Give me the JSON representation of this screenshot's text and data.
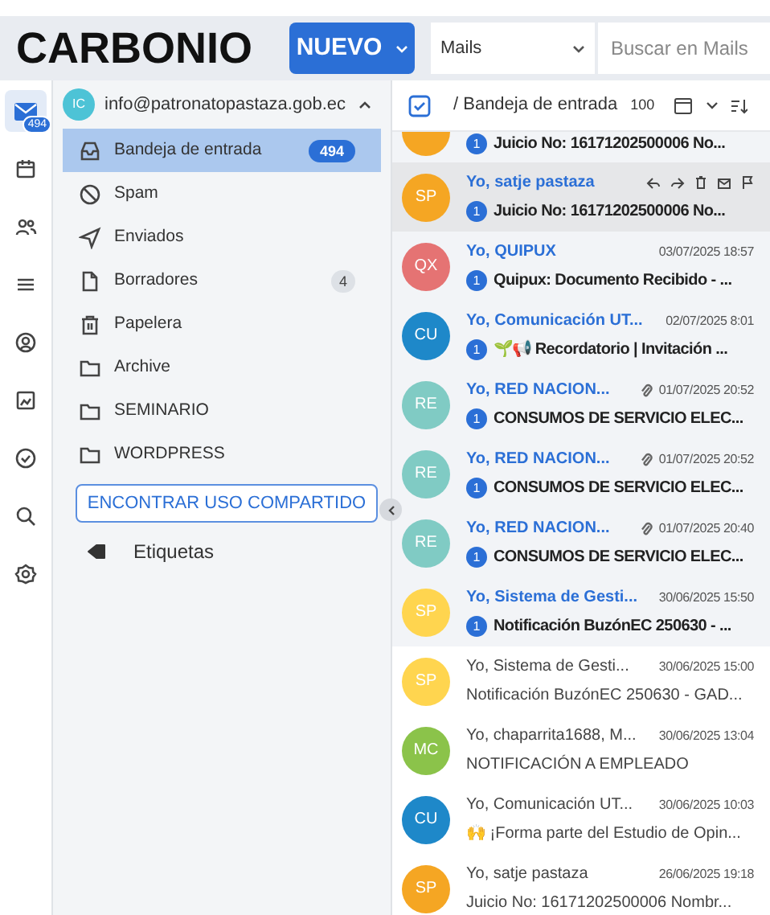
{
  "header": {
    "logo": "CARBONIO",
    "new_button": "NUEVO",
    "search_scope": "Mails",
    "search_placeholder": "Buscar en Mails"
  },
  "rail": [
    {
      "kind": "mail",
      "badge": "494",
      "selected": true
    },
    {
      "kind": "calendar",
      "selected": false
    },
    {
      "kind": "contacts",
      "selected": false
    },
    {
      "kind": "tasks",
      "selected": false
    },
    {
      "kind": "support",
      "selected": false
    },
    {
      "kind": "files",
      "selected": false
    },
    {
      "kind": "check",
      "selected": false
    },
    {
      "kind": "search",
      "selected": false
    },
    {
      "kind": "settings",
      "selected": false
    }
  ],
  "account": {
    "initials": "IC",
    "email": "info@patronatopastaza.gob.ec",
    "expanded": true
  },
  "folders": [
    {
      "kind": "inbox",
      "label": "Bandeja de entrada",
      "count": "494",
      "selected": true
    },
    {
      "kind": "spam",
      "label": "Spam",
      "selected": false
    },
    {
      "kind": "sent",
      "label": "Enviados",
      "selected": false
    },
    {
      "kind": "drafts",
      "label": "Borradores",
      "count": "4",
      "selected": false
    },
    {
      "kind": "trash",
      "label": "Papelera",
      "selected": false
    },
    {
      "kind": "folder",
      "label": "Archive",
      "selected": false
    },
    {
      "kind": "folder",
      "label": "SEMINARIO",
      "selected": false
    },
    {
      "kind": "folder",
      "label": "WORDPRESS",
      "selected": false
    }
  ],
  "shared_button": "ENCONTRAR USO COMPARTIDO",
  "tags_label": "Etiquetas",
  "list_header": {
    "path": "/ Bandeja de entrada",
    "count": "100"
  },
  "messages": [
    {
      "color": "#f5a623",
      "subject": "Juicio No: 16171202500006 No...",
      "unread": true,
      "badge": "1",
      "partial": true
    },
    {
      "initials": "SP",
      "color": "#f5a623",
      "sender": "Yo, satje pastaza",
      "subject": "Juicio No: 16171202500006 No...",
      "unread": true,
      "badge": "1",
      "hovered": true
    },
    {
      "initials": "QX",
      "color": "#e57373",
      "sender": "Yo, QUIPUX",
      "date": "03/07/2025 18:57",
      "subject": "Quipux: Documento Recibido - ...",
      "unread": true,
      "badge": "1"
    },
    {
      "initials": "CU",
      "color": "#1e88c9",
      "sender": "Yo, Comunicación UT...",
      "date": "02/07/2025 8:01",
      "subject": "🌱📢 Recordatorio | Invitación ...",
      "unread": true,
      "badge": "1"
    },
    {
      "initials": "RE",
      "color": "#80cbc4",
      "sender": "Yo, RED NACION...",
      "date": "01/07/2025 20:52",
      "subject": "CONSUMOS DE SERVICIO ELEC...",
      "unread": true,
      "badge": "1",
      "attachment": true
    },
    {
      "initials": "RE",
      "color": "#80cbc4",
      "sender": "Yo, RED NACION...",
      "date": "01/07/2025 20:52",
      "subject": "CONSUMOS DE SERVICIO ELEC...",
      "unread": true,
      "badge": "1",
      "attachment": true
    },
    {
      "initials": "RE",
      "color": "#80cbc4",
      "sender": "Yo, RED NACION...",
      "date": "01/07/2025 20:40",
      "subject": "CONSUMOS DE SERVICIO ELEC...",
      "unread": true,
      "badge": "1",
      "attachment": true
    },
    {
      "initials": "SP",
      "color": "#ffd54f",
      "sender": "Yo, Sistema de Gesti...",
      "date": "30/06/2025 15:50",
      "subject": "Notificación BuzónEC 250630 - ...",
      "unread": true,
      "badge": "1"
    },
    {
      "initials": "SP",
      "color": "#ffd54f",
      "sender": "Yo, Sistema de Gesti...",
      "date": "30/06/2025 15:00",
      "subject": "Notificación BuzónEC 250630 - GAD...",
      "unread": false
    },
    {
      "initials": "MC",
      "color": "#8bc34a",
      "sender": "Yo, chaparrita1688, M...",
      "date": "30/06/2025 13:04",
      "subject": "NOTIFICACIÓN A EMPLEADO",
      "unread": false
    },
    {
      "initials": "CU",
      "color": "#1e88c9",
      "sender": "Yo, Comunicación UT...",
      "date": "30/06/2025 10:03",
      "subject": "🙌 ¡Forma parte del Estudio de Opin...",
      "unread": false
    },
    {
      "initials": "SP",
      "color": "#f5a623",
      "sender": "Yo, satje pastaza",
      "date": "26/06/2025 19:18",
      "subject": "Juicio No: 16171202500006 Nombr...",
      "unread": false
    }
  ]
}
